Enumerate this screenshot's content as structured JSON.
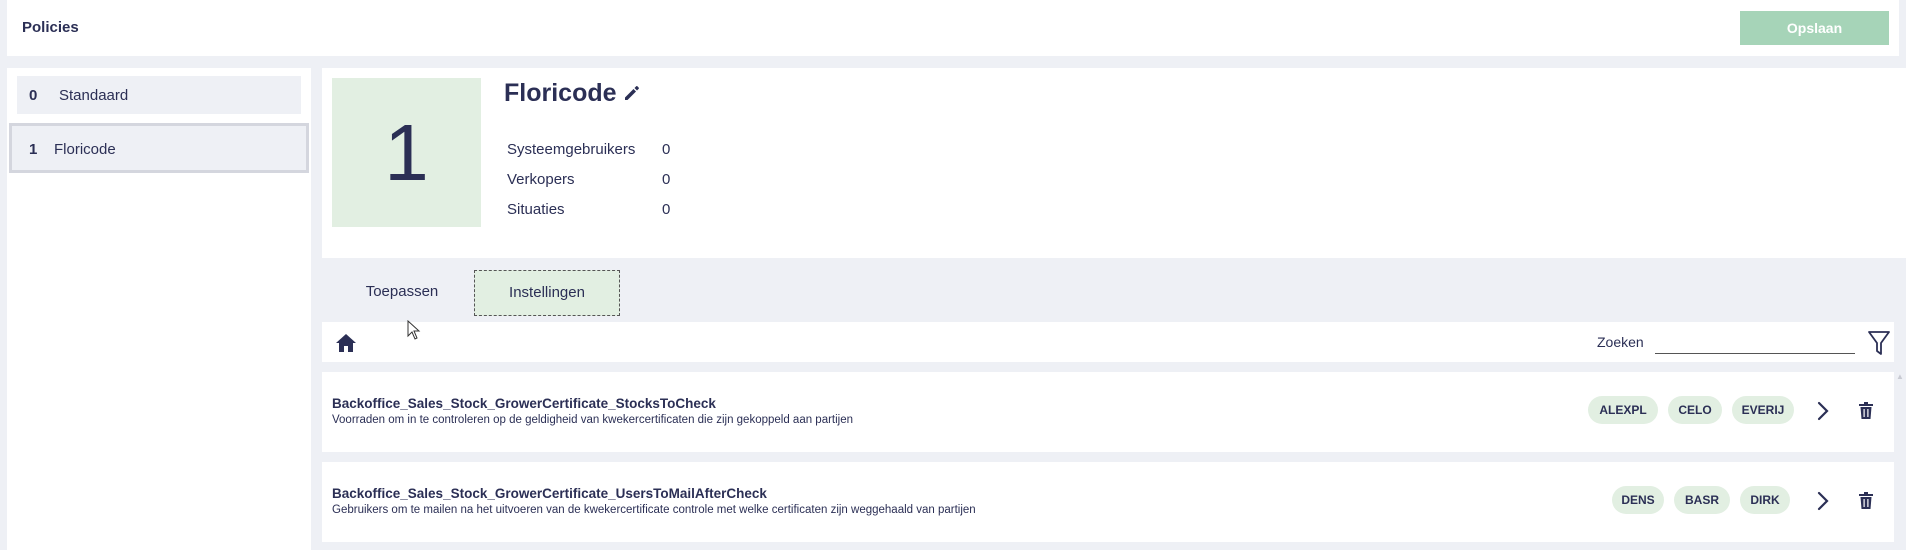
{
  "header": {
    "title": "Policies",
    "save_label": "Opslaan"
  },
  "sidebar": {
    "items": [
      {
        "num": "0",
        "label": "Standaard"
      },
      {
        "num": "1",
        "label": "Floricode"
      }
    ]
  },
  "detail": {
    "number": "1",
    "name": "Floricode",
    "stats": [
      {
        "label": "Systeemgebruikers",
        "value": "0"
      },
      {
        "label": "Verkopers",
        "value": "0"
      },
      {
        "label": "Situaties",
        "value": "0"
      }
    ]
  },
  "tabs": [
    {
      "label": "Toepassen"
    },
    {
      "label": "Instellingen"
    }
  ],
  "toolbar": {
    "search_label": "Zoeken",
    "search_value": ""
  },
  "settings": [
    {
      "name": "Backoffice_Sales_Stock_GrowerCertificate_StocksToCheck",
      "description": "Voorraden om in te controleren op de geldigheid van kwekercertificaten die zijn gekoppeld aan partijen",
      "chips": [
        "ALEXPL",
        "CELO",
        "EVERIJ"
      ]
    },
    {
      "name": "Backoffice_Sales_Stock_GrowerCertificate_UsersToMailAfterCheck",
      "description": "Gebruikers om te mailen na het uitvoeren van de kwekercertificate controle met welke certificaten zijn weggehaald van partijen",
      "chips": [
        "DENS",
        "BASR",
        "DIRK"
      ]
    }
  ],
  "colors": {
    "accent": "#2b2f55",
    "green_bg": "#e2efe2",
    "save_btn": "#a6d4b8",
    "page_bg": "#eef0f5"
  },
  "icons": [
    "edit-icon",
    "home-icon",
    "filter-icon",
    "chevron-right-icon",
    "trash-icon"
  ]
}
